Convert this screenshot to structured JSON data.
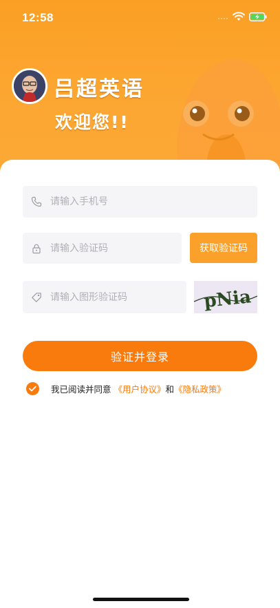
{
  "status_bar": {
    "time": "12:58"
  },
  "brand": {
    "title": "吕超英语",
    "welcome": "欢迎您!!"
  },
  "form": {
    "phone_placeholder": "请输入手机号",
    "sms_code_placeholder": "请输入验证码",
    "get_code_label": "获取验证码",
    "captcha_placeholder": "请输入图形验证码",
    "captcha_text": "pNia",
    "login_label": "验证并登录"
  },
  "agreement": {
    "prefix": "我已阅读并同意",
    "user_agreement": "《用户协议》",
    "conjunction": "和",
    "privacy_policy": "《隐私政策》",
    "checked": true
  },
  "icons": {
    "phone": "phone-icon",
    "lock": "lock-icon",
    "tag": "tag-icon",
    "check": "check-icon",
    "wifi": "wifi-icon",
    "battery": "battery-charging-icon"
  },
  "colors": {
    "header_orange": "#fba12b",
    "accent_orange": "#f97a0d",
    "field_bg": "#f5f5f8"
  }
}
